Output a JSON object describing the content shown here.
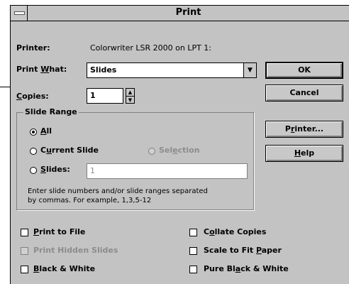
{
  "window": {
    "title": "Print"
  },
  "printer": {
    "label": "Printer:",
    "value": "Colorwriter LSR 2000 on LPT 1:"
  },
  "print_what": {
    "label_pre": "Print ",
    "label_u": "W",
    "label_post": "hat:",
    "value": "Slides"
  },
  "copies": {
    "label_u": "C",
    "label_post": "opies:",
    "value": "1"
  },
  "buttons": {
    "ok": "OK",
    "cancel": "Cancel",
    "printer_pre": "P",
    "printer_u": "r",
    "printer_post": "inter...",
    "help_u": "H",
    "help_post": "elp"
  },
  "slide_range": {
    "title": "Slide Range",
    "all_u": "A",
    "all_post": "ll",
    "current_pre": "C",
    "current_u": "u",
    "current_post": "rrent Slide",
    "selection_pre": "Sel",
    "selection_u": "e",
    "selection_post": "ction",
    "slides_u": "S",
    "slides_post": "lides:",
    "slides_value": "1",
    "hint_line1": "Enter slide numbers and/or slide ranges separated",
    "hint_line2": "by commas. For example, 1,3,5-12"
  },
  "options": {
    "print_to_file_u": "P",
    "print_to_file_post": "rint to File",
    "print_hidden": "Print Hidden Slides",
    "bw_u": "B",
    "bw_post": "lack & White",
    "collate_pre": "C",
    "collate_u": "o",
    "collate_post": "llate Copies",
    "scale_pre": "Scale to Fit ",
    "scale_u": "P",
    "scale_post": "aper",
    "pure_pre": "Pure Bl",
    "pure_u": "a",
    "pure_post": "ck & White"
  }
}
